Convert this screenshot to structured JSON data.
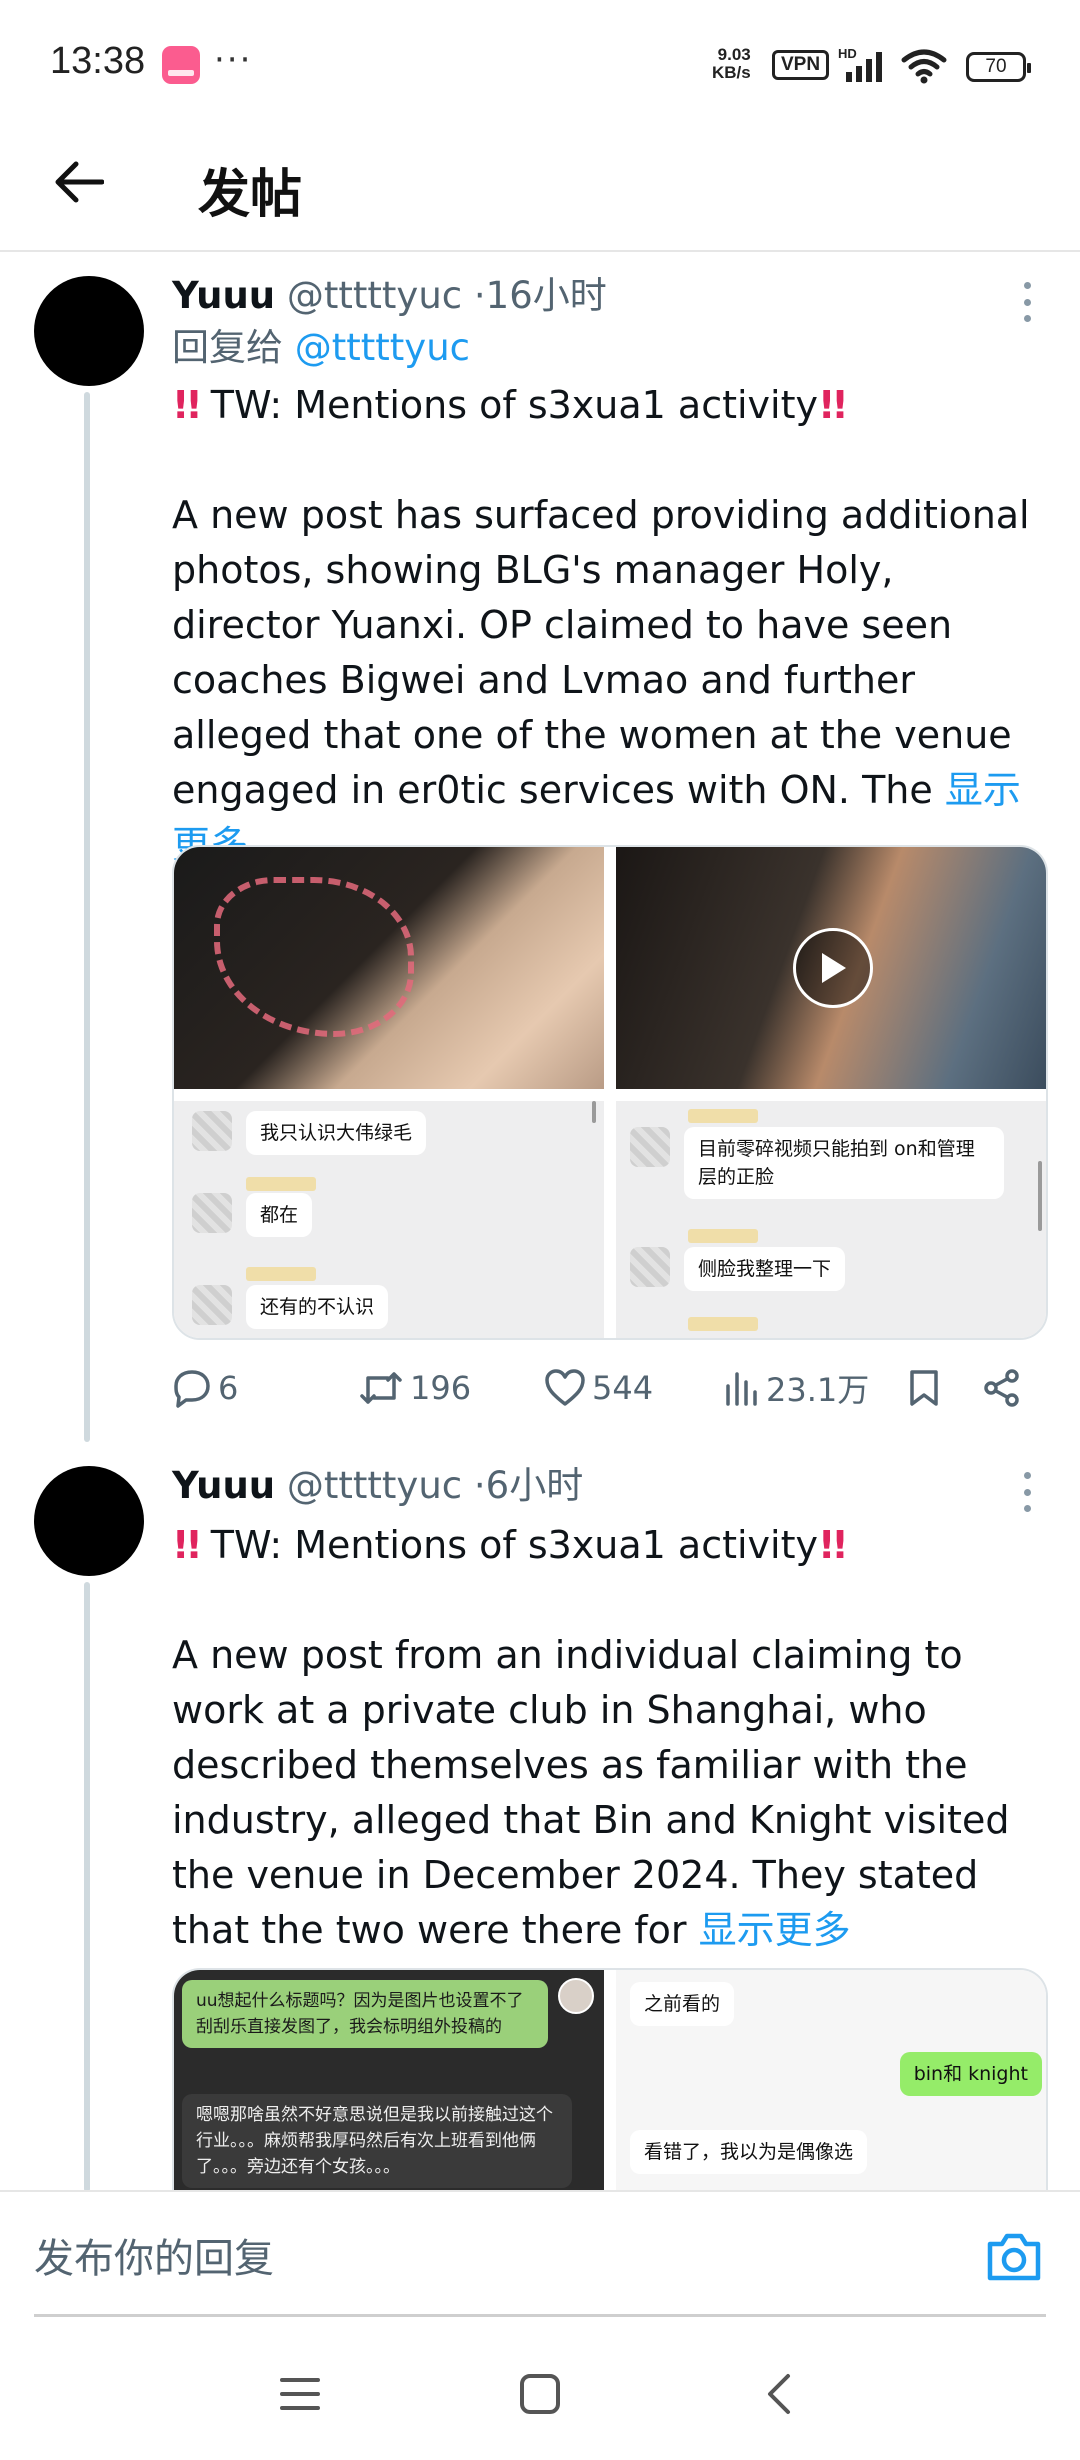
{
  "status_bar": {
    "time": "13:38",
    "dots": "···",
    "net_speed_value": "9.03",
    "net_speed_unit": "KB/s",
    "vpn": "VPN",
    "network_tag": "HD",
    "battery": "70"
  },
  "header": {
    "title": "发帖"
  },
  "tweets": [
    {
      "name": "Yuuu",
      "handle": "@tttttyuc",
      "separator": "·",
      "time": "16小时",
      "reply_prefix": "回复给",
      "reply_handle": "@tttttyuc",
      "warning": "TW: Mentions of s3xua1 activity",
      "body": "A new post has surfaced providing additional photos, showing BLG's manager Holy, director Yuanxi. OP claimed to have seen coaches Bigwei and Lvmao and further alleged that one of the women at the venue engaged in er0tic services with ON. The",
      "show_more": "显示更多",
      "media": {
        "chat_left": [
          "我只认识大伟绿毛",
          "都在",
          "还有的不认识"
        ],
        "chat_right": [
          "目前零碎视频只能拍到 on和管理层的正脸",
          "侧脸我整理一下"
        ]
      },
      "stats": {
        "replies": "6",
        "retweets": "196",
        "likes": "544",
        "views": "23.1万"
      }
    },
    {
      "name": "Yuuu",
      "handle": "@tttttyuc",
      "separator": "·",
      "time": "6小时",
      "warning": "TW: Mentions of s3xua1 activity",
      "body": "A new post from an individual claiming to work at a private club in Shanghai, who described themselves as familiar with the industry, alleged that Bin and Knight visited the venue in December 2024. They stated that the two were there for",
      "show_more": "显示更多",
      "media": {
        "chat_left_1": "uu想起什么标题吗？因为是图片也设置不了刮刮乐直接发图了，我会标明组外投稿的",
        "chat_left_2": "嗯嗯那啥虽然不好意思说但是我以前接触过这个行业。。。麻烦帮我厚码然后有次上班看到他俩了。。。旁边还有个女孩。。。",
        "chat_right_1": "之前看的",
        "chat_right_2": "bin和 knight",
        "chat_right_3": "看错了，我以为是偶像选"
      }
    }
  ],
  "composer": {
    "placeholder": "发布你的回复"
  },
  "colors": {
    "link": "#1d9bf0",
    "muted": "#536471",
    "warning": "#e0245e"
  }
}
